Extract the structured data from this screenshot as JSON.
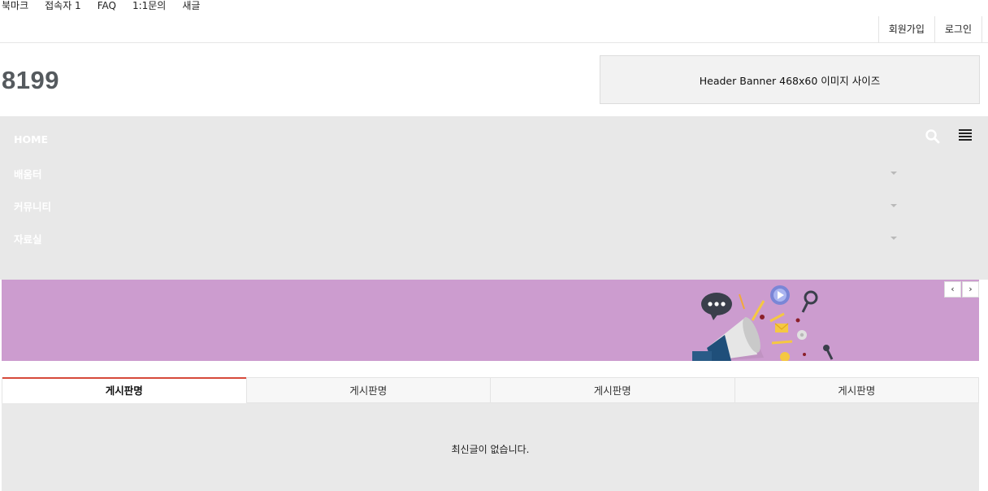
{
  "topbar": {
    "links": [
      "북마크",
      "접속자 1",
      "FAQ",
      "1:1문의",
      "새글"
    ],
    "auth": {
      "join": "회원가입",
      "login": "로그인"
    }
  },
  "header": {
    "logo": "8199",
    "banner_text": "Header Banner 468x60 이미지 사이즈"
  },
  "nav": {
    "items": [
      "HOME",
      "배움터",
      "커뮤니티",
      "자료실"
    ],
    "icons": [
      "search-icon",
      "menu-icon"
    ]
  },
  "slider": {
    "background": "#cc9ccf",
    "prev_label": "‹",
    "next_label": "›"
  },
  "tabs": {
    "items": [
      "게시판명",
      "게시판명",
      "게시판명",
      "게시판명"
    ],
    "active_index": 0,
    "accent": "#d64a3a",
    "empty_text": "최신글이 없습니다."
  }
}
